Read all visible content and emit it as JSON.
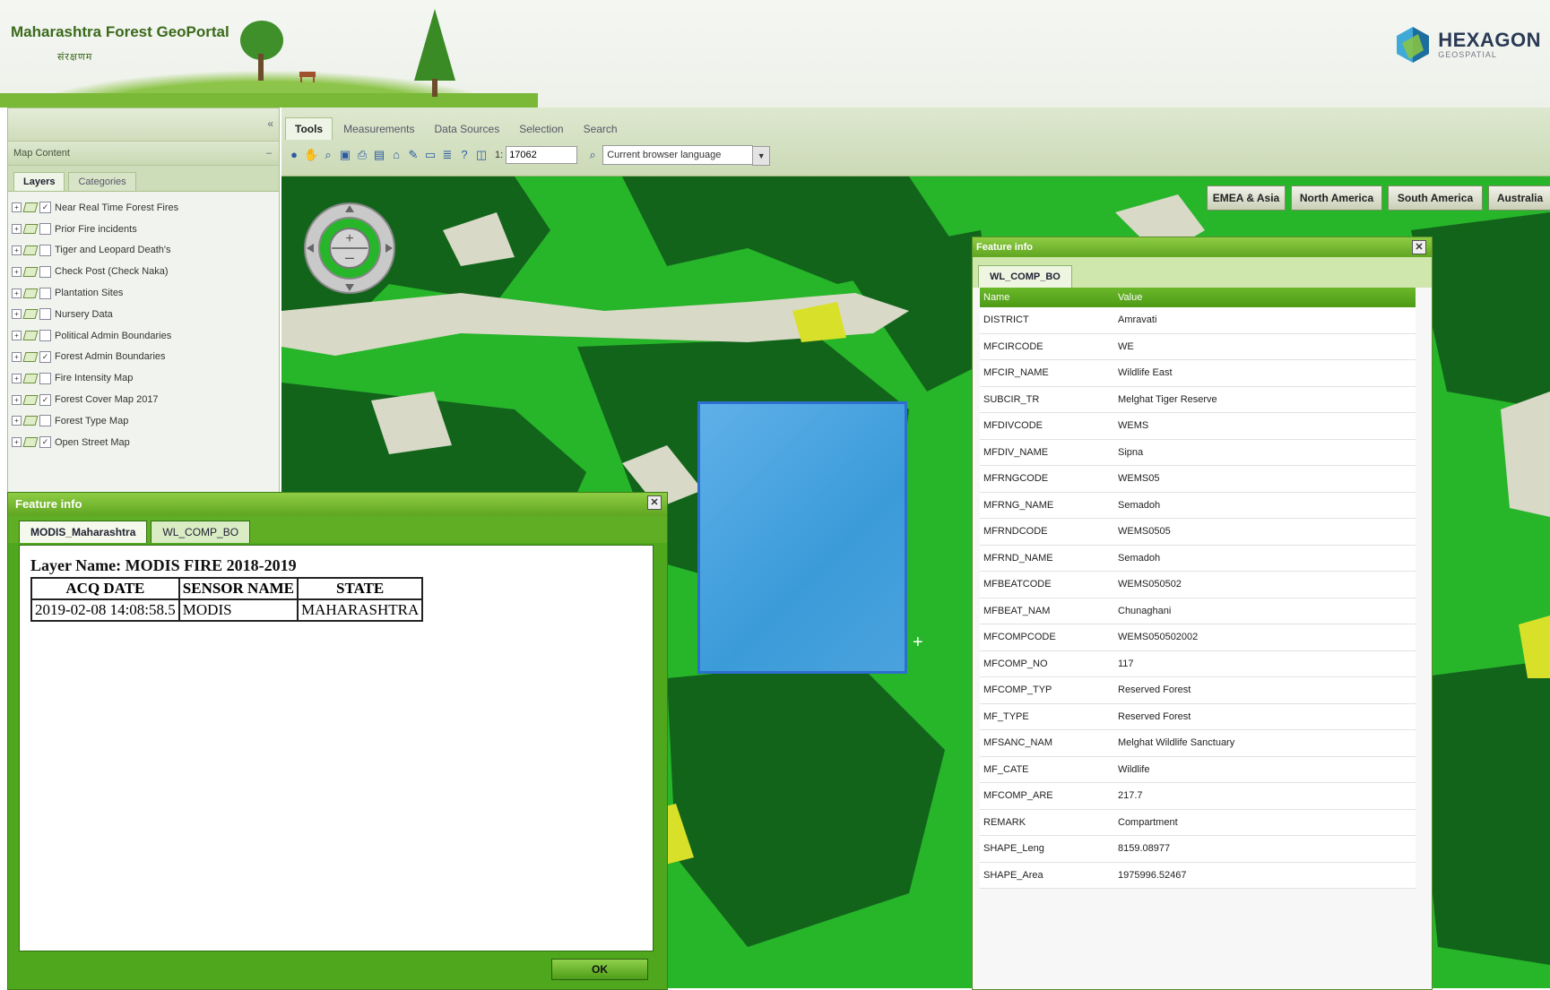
{
  "header": {
    "title": "Maharashtra Forest GeoPortal",
    "subtitle": "संरक्षणम",
    "brand": "HEXAGON",
    "brand_sub": "GEOSPATIAL"
  },
  "left_panel": {
    "collapse": "«",
    "map_content": "Map Content",
    "tabs": [
      "Layers",
      "Categories"
    ],
    "layers": [
      {
        "label": "Near Real Time Forest Fires",
        "checked": true
      },
      {
        "label": "Prior Fire incidents",
        "checked": false
      },
      {
        "label": "Tiger and Leopard Death's",
        "checked": false
      },
      {
        "label": "Check Post (Check Naka)",
        "checked": false
      },
      {
        "label": "Plantation Sites",
        "checked": false
      },
      {
        "label": "Nursery Data",
        "checked": false
      },
      {
        "label": "Political Admin Boundaries",
        "checked": false
      },
      {
        "label": "Forest Admin Boundaries",
        "checked": true
      },
      {
        "label": "Fire Intensity Map",
        "checked": false
      },
      {
        "label": "Forest Cover Map 2017",
        "checked": true
      },
      {
        "label": "Forest Type Map",
        "checked": false
      },
      {
        "label": "Open Street Map",
        "checked": true
      }
    ]
  },
  "toolbar": {
    "tabs": [
      "Tools",
      "Measurements",
      "Data Sources",
      "Selection",
      "Search"
    ],
    "scale_prefix": "1:",
    "scale_value": "17062",
    "language": "Current browser language"
  },
  "map": {
    "regions": [
      "EMEA & Asia",
      "North America",
      "South America",
      "Australia"
    ],
    "colors": {
      "forest_light": "#27b52a",
      "forest_dark": "#12641a",
      "clearing": "#d8d9c6",
      "scrub": "#d9e02a",
      "aoi": "#3b9bd9"
    }
  },
  "feature_info_right": {
    "title": "Feature info",
    "tab": "WL_COMP_BO",
    "columns": [
      "Name",
      "Value"
    ],
    "rows": [
      [
        "DISTRICT",
        "Amravati"
      ],
      [
        "MFCIRCODE",
        "WE"
      ],
      [
        "MFCIR_NAME",
        "Wildlife East"
      ],
      [
        "SUBCIR_TR",
        "Melghat Tiger Reserve"
      ],
      [
        "MFDIVCODE",
        "WEMS"
      ],
      [
        "MFDIV_NAME",
        "Sipna"
      ],
      [
        "MFRNGCODE",
        "WEMS05"
      ],
      [
        "MFRNG_NAME",
        "Semadoh"
      ],
      [
        "MFRNDCODE",
        "WEMS0505"
      ],
      [
        "MFRND_NAME",
        "Semadoh"
      ],
      [
        "MFBEATCODE",
        "WEMS050502"
      ],
      [
        "MFBEAT_NAM",
        "Chunaghani"
      ],
      [
        "MFCOMPCODE",
        "WEMS050502002"
      ],
      [
        "MFCOMP_NO",
        "117"
      ],
      [
        "MFCOMP_TYP",
        "Reserved Forest"
      ],
      [
        "MF_TYPE",
        "Reserved Forest"
      ],
      [
        "MFSANC_NAM",
        "Melghat Wildlife Sanctuary"
      ],
      [
        "MF_CATE",
        "Wildlife"
      ],
      [
        "MFCOMP_ARE",
        "217.7"
      ],
      [
        "REMARK",
        "Compartment"
      ],
      [
        "SHAPE_Leng",
        "8159.08977"
      ],
      [
        "SHAPE_Area",
        "1975996.52467"
      ]
    ]
  },
  "feature_info_left": {
    "title": "Feature info",
    "tabs": [
      "MODIS_Maharashtra",
      "WL_COMP_BO"
    ],
    "layer_name": "Layer Name: MODIS FIRE 2018-2019",
    "columns": [
      "ACQ DATE",
      "SENSOR NAME",
      "STATE"
    ],
    "rows": [
      [
        "2019-02-08 14:08:58.5",
        "MODIS",
        "MAHARASHTRA"
      ]
    ],
    "ok": "OK"
  }
}
